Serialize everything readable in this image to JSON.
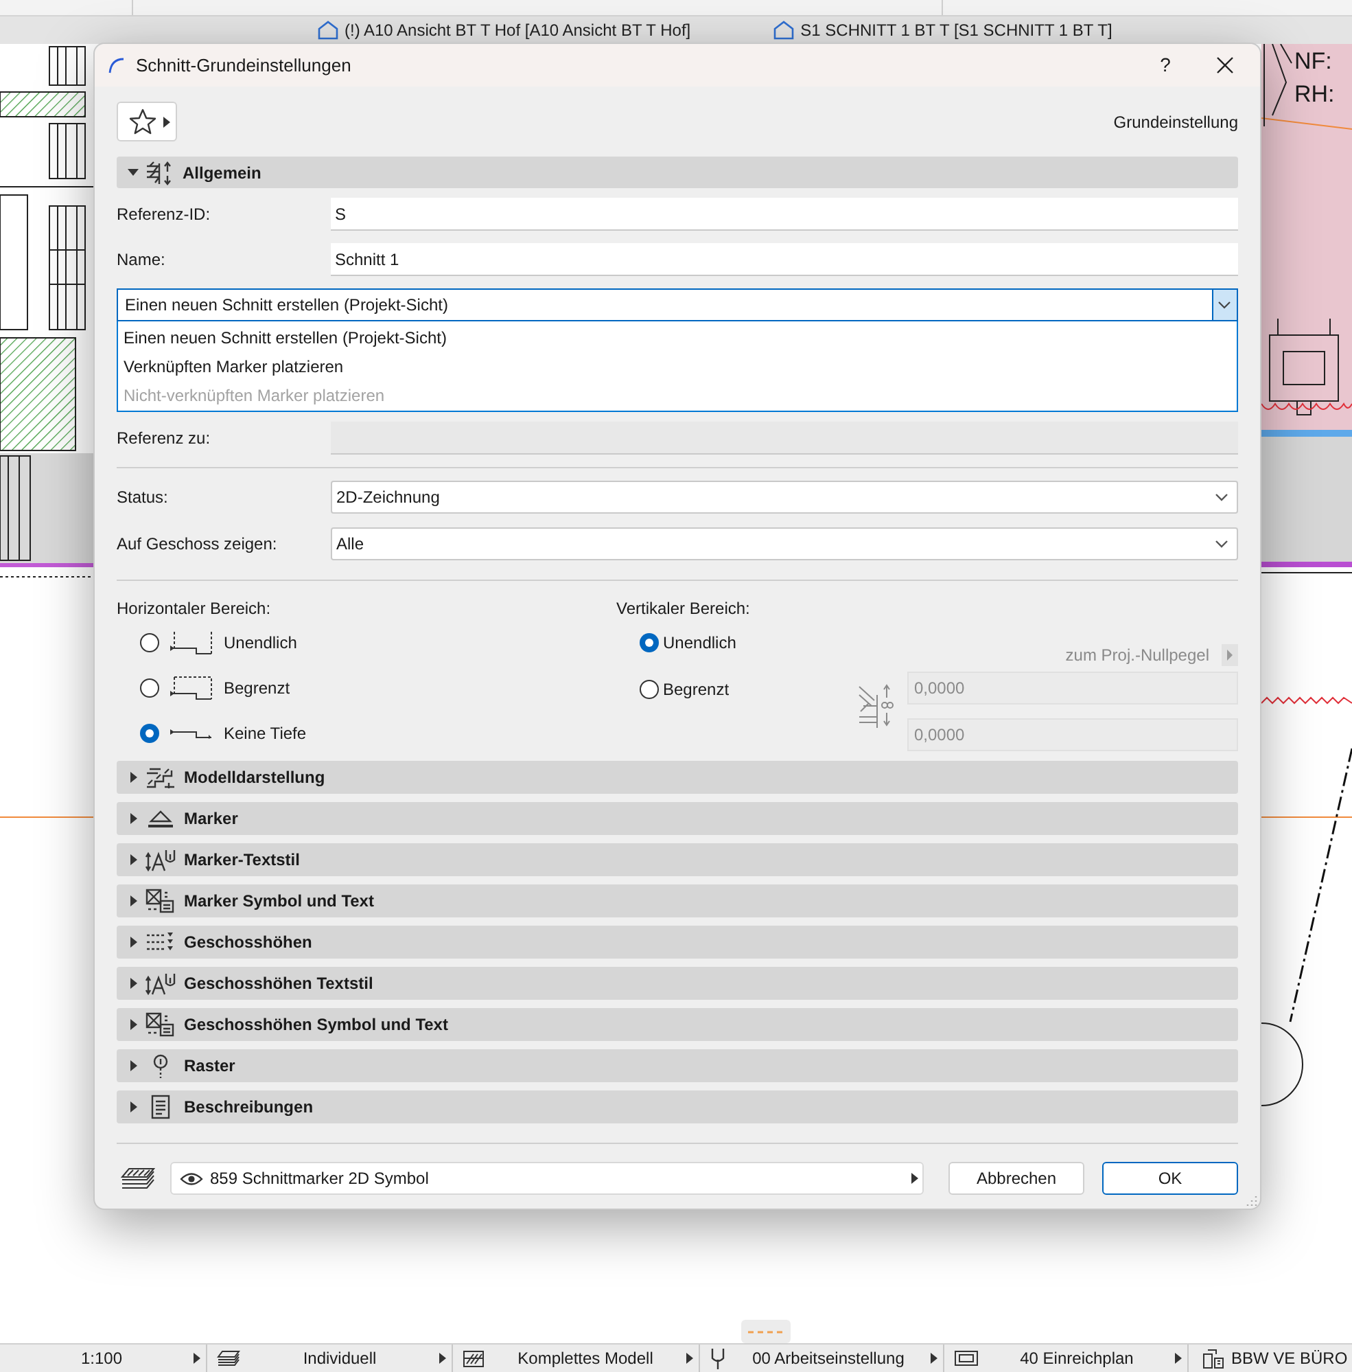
{
  "drawing": {
    "labels": [
      "NF:",
      "RH:"
    ]
  },
  "view_tabs": [
    {
      "label": "(!) A10 Ansicht BT T Hof [A10 Ansicht BT T Hof]"
    },
    {
      "label": "S1 SCHNITT 1 BT T [S1 SCHNITT 1 BT T]"
    }
  ],
  "dialog": {
    "title": "Schnitt-Grundeinstellungen",
    "help": "?",
    "preset": "Grundeinstellung",
    "general": {
      "title": "Allgemein",
      "expanded": true,
      "fields": [
        {
          "label": "Referenz-ID:",
          "value": "S"
        },
        {
          "label": "Name:",
          "value": "Schnitt 1"
        }
      ],
      "mode_select": {
        "value": "Einen neuen Schnitt erstellen (Projekt-Sicht)",
        "expanded": true,
        "options": [
          {
            "label": "Einen neuen Schnitt erstellen (Projekt-Sicht)",
            "disabled": false
          },
          {
            "label": "Verknüpften Marker platzieren",
            "disabled": false
          },
          {
            "label": "Nicht-verknüpften Marker platzieren",
            "disabled": true
          }
        ]
      },
      "reference": {
        "label": "Referenz zu:",
        "disabled": true
      },
      "selects": [
        {
          "label": "Status:",
          "value": "2D-Zeichnung"
        },
        {
          "label": "Auf Geschoss zeigen:",
          "value": "Alle"
        }
      ],
      "horizontal_range": {
        "label": "Horizontaler Bereich:",
        "options": [
          {
            "kind": "infinite",
            "label": "Unendlich",
            "selected": false
          },
          {
            "kind": "limited",
            "label": "Begrenzt",
            "selected": false
          },
          {
            "kind": "none",
            "label": "Keine Tiefe",
            "selected": true
          }
        ]
      },
      "vertical_range": {
        "label": "Vertikaler Bereich:",
        "options": [
          {
            "label": "Unendlich",
            "selected": true
          },
          {
            "label": "Begrenzt",
            "selected": false
          }
        ],
        "reference_button": "zum Proj.-Nullpegel",
        "limits": [
          {
            "value": "0,0000",
            "disabled": true
          },
          {
            "value": "0,0000",
            "disabled": true
          }
        ]
      }
    },
    "sections": [
      {
        "kind": "model",
        "title": "Modelldarstellung",
        "expanded": false
      },
      {
        "kind": "marker",
        "title": "Marker",
        "expanded": false
      },
      {
        "kind": "text-style",
        "title": "Marker-Textstil",
        "expanded": false
      },
      {
        "kind": "symbol-text",
        "title": "Marker Symbol und Text",
        "expanded": false
      },
      {
        "kind": "levels",
        "title": "Geschosshöhen",
        "expanded": false
      },
      {
        "kind": "text-style",
        "title": "Geschosshöhen Textstil",
        "expanded": false
      },
      {
        "kind": "symbol-text",
        "title": "Geschosshöhen Symbol und Text",
        "expanded": false
      },
      {
        "kind": "grid",
        "title": "Raster",
        "expanded": false
      },
      {
        "kind": "descriptions",
        "title": "Beschreibungen",
        "expanded": false
      }
    ],
    "symbol": {
      "value": "859 Schnittmarker 2D Symbol"
    },
    "buttons": [
      {
        "label": "Abbrechen",
        "default": false
      },
      {
        "label": "OK",
        "default": true
      }
    ]
  },
  "status_bar": [
    {
      "kind": "scale",
      "label": "1:100",
      "menu": true
    },
    {
      "kind": "layers",
      "label": "Individuell",
      "menu": true
    },
    {
      "kind": "model",
      "label": "Komplettes Modell",
      "menu": true
    },
    {
      "kind": "pen",
      "label": "00 Arbeitseinstellung",
      "menu": true
    },
    {
      "kind": "layout",
      "label": "40 Einreichplan",
      "menu": true
    },
    {
      "kind": "publisher",
      "label": "BBW VE BÜRO",
      "menu": false
    }
  ]
}
